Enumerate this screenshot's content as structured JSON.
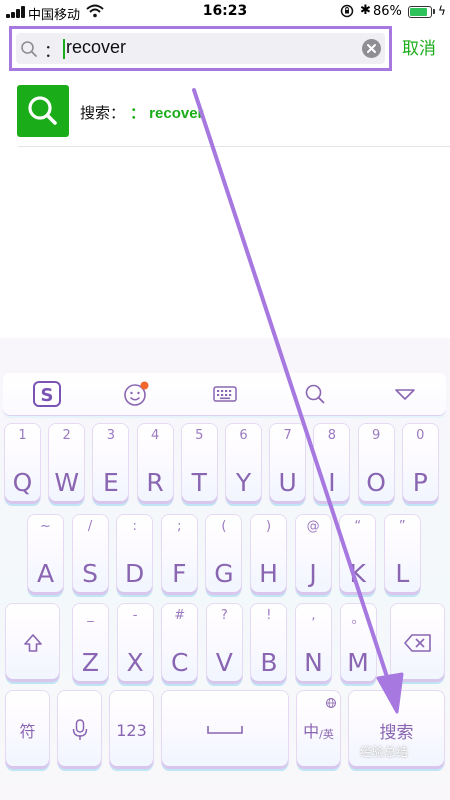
{
  "status_bar": {
    "carrier": "中国移动",
    "time": "16:23",
    "battery_percent": "86%",
    "battery_level": 0.86,
    "icons": [
      "signal-icon",
      "wifi-icon",
      "rotation-lock-icon",
      "bluetooth-icon",
      "battery-icon",
      "charging-icon"
    ]
  },
  "search": {
    "prefix": "：",
    "query": "recover",
    "cancel_label": "取消"
  },
  "suggestion": {
    "label": "搜索：",
    "query": "： recover"
  },
  "keyboard": {
    "toolbar_icons": [
      "sogou-logo-icon",
      "emoji-icon",
      "keyboard-icon",
      "search-icon",
      "collapse-triangle-icon"
    ],
    "row1": [
      {
        "main": "Q",
        "sub": "1"
      },
      {
        "main": "W",
        "sub": "2"
      },
      {
        "main": "E",
        "sub": "3"
      },
      {
        "main": "R",
        "sub": "4"
      },
      {
        "main": "T",
        "sub": "5"
      },
      {
        "main": "Y",
        "sub": "6"
      },
      {
        "main": "U",
        "sub": "7"
      },
      {
        "main": "I",
        "sub": "8"
      },
      {
        "main": "O",
        "sub": "9"
      },
      {
        "main": "P",
        "sub": "0"
      }
    ],
    "row2": [
      {
        "main": "A",
        "sub": "~"
      },
      {
        "main": "S",
        "sub": "/"
      },
      {
        "main": "D",
        "sub": ":"
      },
      {
        "main": "F",
        "sub": ";"
      },
      {
        "main": "G",
        "sub": "("
      },
      {
        "main": "H",
        "sub": ")"
      },
      {
        "main": "J",
        "sub": "@"
      },
      {
        "main": "K",
        "sub": "“"
      },
      {
        "main": "L",
        "sub": "”"
      }
    ],
    "row3": [
      {
        "main": "Z",
        "sub": "_"
      },
      {
        "main": "X",
        "sub": "-"
      },
      {
        "main": "C",
        "sub": "#"
      },
      {
        "main": "V",
        "sub": "?"
      },
      {
        "main": "B",
        "sub": "!"
      },
      {
        "main": "N",
        "sub": ","
      },
      {
        "main": "M",
        "sub": "。"
      }
    ],
    "symbol_key": "符",
    "number_key": "123",
    "lang_key_main": "中",
    "lang_key_sub": "/英",
    "search_key": "搜索"
  },
  "watermark": "经验总结",
  "colors": {
    "accent_green": "#1aad19",
    "annotation_purple": "#a678e0",
    "key_text": "#8a66b2"
  }
}
